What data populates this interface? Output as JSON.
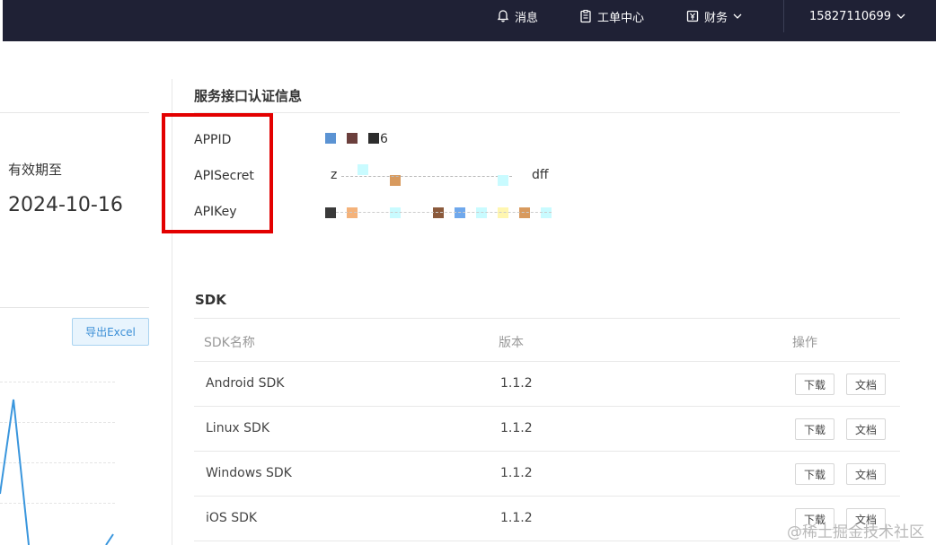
{
  "topbar": {
    "messages_label": "消息",
    "tickets_label": "工单中心",
    "finance_label": "财务",
    "user_phone": "15827110699"
  },
  "left": {
    "expiry_label": "有效期至",
    "expiry_date": "2024-10-16",
    "export_label": "导出Excel"
  },
  "auth": {
    "title": "服务接口认证信息",
    "appid_label": "APPID",
    "apisecret_label": "APISecret",
    "apikey_label": "APIKey",
    "appid_visible": "6",
    "apisecret_visible_start": "z",
    "apisecret_visible_end": "dff"
  },
  "sdk": {
    "title": "SDK",
    "headers": [
      "SDK名称",
      "版本",
      "操作"
    ],
    "rows": [
      {
        "name": "Android SDK",
        "version": "1.1.2",
        "download": "下载",
        "docs": "文档"
      },
      {
        "name": "Linux SDK",
        "version": "1.1.2",
        "download": "下载",
        "docs": "文档"
      },
      {
        "name": "Windows SDK",
        "version": "1.1.2",
        "download": "下载",
        "docs": "文档"
      },
      {
        "name": "iOS SDK",
        "version": "1.1.2",
        "download": "下载",
        "docs": "文档"
      }
    ]
  },
  "watermark": "@稀土掘金技术社区",
  "colors": {
    "topbar_bg": "#1f2135",
    "highlight_red": "#e30000",
    "accent_blue": "#3a8ed6",
    "chart_line": "#3a96dd"
  },
  "icons": [
    "bell-icon",
    "clipboard-icon",
    "yen-icon",
    "chevron-down-icon"
  ]
}
